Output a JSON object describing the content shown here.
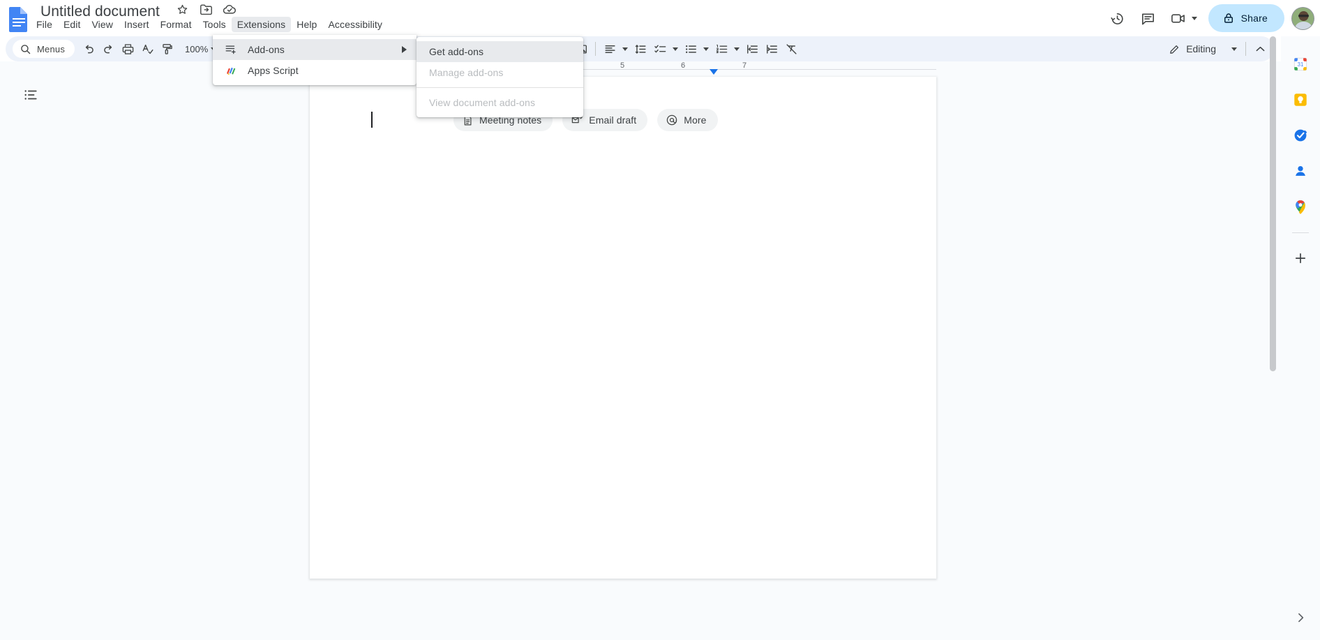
{
  "app": {
    "name": "Google Docs",
    "logo_icon": "docs-logo-icon"
  },
  "header": {
    "doc_title": "Untitled document",
    "title_icons": [
      {
        "name": "star-icon",
        "label": "Star"
      },
      {
        "name": "move-to-folder-icon",
        "label": "Move to folder"
      },
      {
        "name": "cloud-saved-icon",
        "label": "Document status"
      }
    ],
    "menus": [
      {
        "label": "File",
        "active": false
      },
      {
        "label": "Edit",
        "active": false
      },
      {
        "label": "View",
        "active": false
      },
      {
        "label": "Insert",
        "active": false
      },
      {
        "label": "Format",
        "active": false
      },
      {
        "label": "Tools",
        "active": false
      },
      {
        "label": "Extensions",
        "active": true
      },
      {
        "label": "Help",
        "active": false
      },
      {
        "label": "Accessibility",
        "active": false
      }
    ],
    "right_actions": [
      {
        "name": "version-history-icon",
        "label": "Version history"
      },
      {
        "name": "comment-icon",
        "label": "Open comment history"
      },
      {
        "name": "meet-camera-icon",
        "label": "Join a call here"
      }
    ],
    "share_label": "Share",
    "share_icon": "lock-icon",
    "share_bg": "#c2e7ff",
    "avatar_name": "user-avatar"
  },
  "toolbar": {
    "search_label": "Menus",
    "search_icon": "search-icon",
    "zoom_level": "100%",
    "buttons": [
      {
        "name": "undo-button",
        "label": "Undo"
      },
      {
        "name": "redo-button",
        "label": "Redo"
      },
      {
        "name": "print-button",
        "label": "Print"
      },
      {
        "name": "spelling-check-button",
        "label": "Spelling and grammar check"
      },
      {
        "name": "paint-format-button",
        "label": "Paint format"
      },
      {
        "name": "insert-image-button",
        "label": "Insert image"
      },
      {
        "name": "align-button",
        "label": "Align"
      },
      {
        "name": "line-spacing-button",
        "label": "Line & paragraph spacing"
      },
      {
        "name": "checklist-button",
        "label": "Checklist"
      },
      {
        "name": "bulleted-list-button",
        "label": "Bulleted list"
      },
      {
        "name": "numbered-list-button",
        "label": "Numbered list"
      },
      {
        "name": "decrease-indent-button",
        "label": "Decrease indent"
      },
      {
        "name": "increase-indent-button",
        "label": "Increase indent"
      },
      {
        "name": "clear-formatting-button",
        "label": "Clear formatting"
      }
    ],
    "mode_label": "Editing",
    "mode_icon": "pencil-icon",
    "collapse_icon": "chevron-up-icon"
  },
  "ruler": {
    "numbers": [
      "5",
      "6",
      "7"
    ],
    "indent_marker": "right-indent-marker"
  },
  "document": {
    "outline_icon": "outline-icon",
    "chips": [
      {
        "label": "Meeting notes",
        "icon": "doc-outline-icon"
      },
      {
        "label": "Email draft",
        "icon": "email-draft-icon"
      },
      {
        "label": "More",
        "icon": "at-sign-icon"
      }
    ]
  },
  "extensions_menu": {
    "items": [
      {
        "label": "Add-ons",
        "icon": "addons-icon",
        "has_submenu": true,
        "highlighted": true,
        "disabled": false
      },
      {
        "label": "Apps Script",
        "icon": "apps-script-icon",
        "has_submenu": false,
        "highlighted": false,
        "disabled": false
      }
    ]
  },
  "addons_submenu": {
    "items": [
      {
        "label": "Get add-ons",
        "disabled": false,
        "highlighted": true
      },
      {
        "label": "Manage add-ons",
        "disabled": true,
        "highlighted": false
      },
      {
        "separator": true
      },
      {
        "label": "View document add-ons",
        "disabled": true,
        "highlighted": false
      }
    ]
  },
  "side_panel": {
    "items": [
      {
        "name": "google-calendar-icon",
        "label": "Calendar"
      },
      {
        "name": "google-keep-icon",
        "label": "Keep"
      },
      {
        "name": "google-tasks-icon",
        "label": "Tasks"
      },
      {
        "name": "google-contacts-icon",
        "label": "Contacts"
      },
      {
        "name": "google-maps-icon",
        "label": "Maps"
      }
    ],
    "add_label": "Get add-ons",
    "add_icon": "plus-icon",
    "expand_icon": "chevron-right-icon"
  }
}
